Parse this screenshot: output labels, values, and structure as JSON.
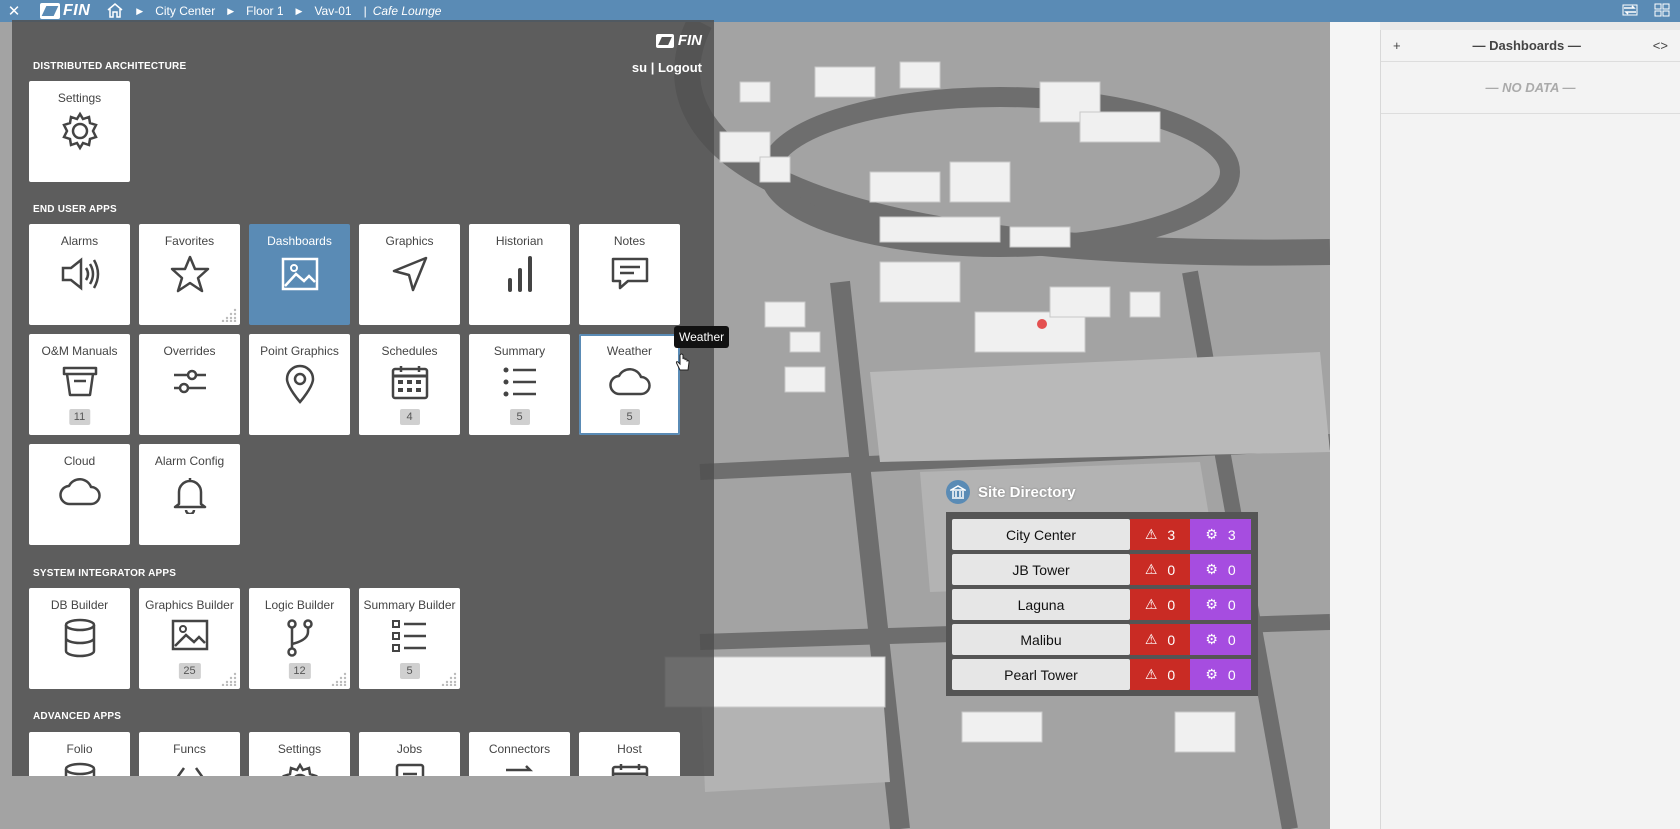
{
  "topbar": {
    "logo": "FIN",
    "breadcrumb": [
      "City Center",
      "Floor 1",
      "Vav-01"
    ],
    "current": "Cafe Lounge"
  },
  "launcher": {
    "logo": "FIN",
    "user": "su",
    "logout": "Logout",
    "sections": {
      "distributed": "DISTRIBUTED ARCHITECTURE",
      "end_user": "END USER APPS",
      "system_integrator": "SYSTEM INTEGRATOR APPS",
      "advanced": "ADVANCED APPS"
    },
    "distributed_apps": [
      {
        "label": "Settings",
        "icon": "gear-icon"
      }
    ],
    "end_user_apps": [
      {
        "label": "Alarms",
        "icon": "speaker-icon"
      },
      {
        "label": "Favorites",
        "icon": "star-icon"
      },
      {
        "label": "Dashboards",
        "icon": "image-icon"
      },
      {
        "label": "Graphics",
        "icon": "navigation-arrow-icon"
      },
      {
        "label": "Historian",
        "icon": "bar-chart-icon"
      },
      {
        "label": "Notes",
        "icon": "message-icon"
      },
      {
        "label": "O&M Manuals",
        "icon": "basket-icon",
        "badge": "11"
      },
      {
        "label": "Overrides",
        "icon": "sliders-icon"
      },
      {
        "label": "Point Graphics",
        "icon": "map-pin-icon"
      },
      {
        "label": "Schedules",
        "icon": "calendar-icon",
        "badge": "4"
      },
      {
        "label": "Summary",
        "icon": "list-icon",
        "badge": "5"
      },
      {
        "label": "Weather",
        "icon": "cloud-icon",
        "badge": "5"
      },
      {
        "label": "Cloud",
        "icon": "cloud-icon"
      },
      {
        "label": "Alarm Config",
        "icon": "bell-icon"
      }
    ],
    "system_integrator_apps": [
      {
        "label": "DB Builder",
        "icon": "database-icon"
      },
      {
        "label": "Graphics Builder",
        "icon": "image-icon",
        "badge": "25"
      },
      {
        "label": "Logic Builder",
        "icon": "branch-icon",
        "badge": "12"
      },
      {
        "label": "Summary Builder",
        "icon": "list-icon",
        "badge": "5"
      }
    ],
    "advanced_apps": [
      {
        "label": "Folio",
        "icon": "database-icon"
      },
      {
        "label": "Funcs",
        "icon": "code-icon"
      },
      {
        "label": "Settings",
        "icon": "gear-icon"
      },
      {
        "label": "Jobs",
        "icon": "document-icon"
      },
      {
        "label": "Connectors",
        "icon": "connector-icon"
      },
      {
        "label": "Host",
        "icon": "calendar-icon"
      }
    ]
  },
  "tooltip": "Weather",
  "site_directory": {
    "title": "Site Directory",
    "sites": [
      {
        "name": "City Center",
        "alarms": "3",
        "configs": "3"
      },
      {
        "name": "JB Tower",
        "alarms": "0",
        "configs": "0"
      },
      {
        "name": "Laguna",
        "alarms": "0",
        "configs": "0"
      },
      {
        "name": "Malibu",
        "alarms": "0",
        "configs": "0"
      },
      {
        "name": "Pearl Tower",
        "alarms": "0",
        "configs": "0"
      }
    ]
  },
  "dashboards_panel": {
    "add": "+",
    "title": "— Dashboards —",
    "toggle": "<>",
    "empty": "— NO DATA —"
  },
  "colors": {
    "accent": "#5a8bb5",
    "alarm": "#c92b24",
    "config": "#a64de0"
  }
}
